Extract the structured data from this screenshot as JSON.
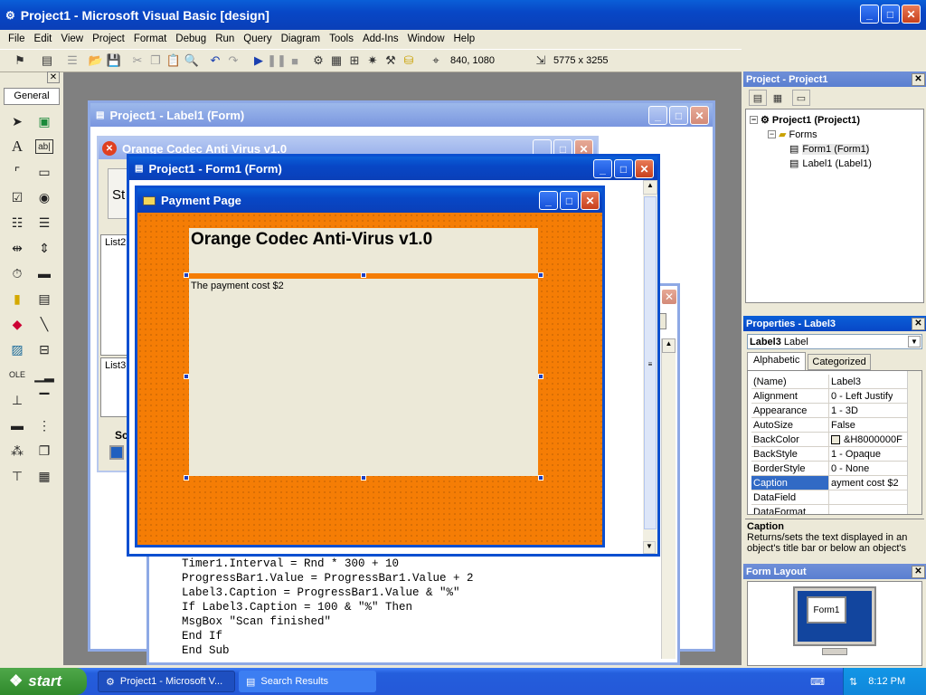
{
  "app": {
    "title": "Project1 - Microsoft Visual Basic [design]"
  },
  "menu": [
    "File",
    "Edit",
    "View",
    "Project",
    "Format",
    "Debug",
    "Run",
    "Query",
    "Diagram",
    "Tools",
    "Add-Ins",
    "Window",
    "Help"
  ],
  "toolbar": {
    "position": "840, 1080",
    "size": "5775 x 3255"
  },
  "toolbox": {
    "tab": "General"
  },
  "windows": {
    "label1_form": "Project1 - Label1 (Form)",
    "orange_codec": "Orange Codec Anti Virus v1.0",
    "form1_form": "Project1 - Form1 (Form)",
    "payment_page": "Payment Page"
  },
  "bg_form": {
    "st": "St",
    "list2": "List2",
    "list3": "List3",
    "sc": "Sc"
  },
  "payment": {
    "heading": "Orange Codec Anti-Virus v1.0",
    "cost": "The payment cost $2"
  },
  "code": [
    "Timer1.Interval = Rnd * 300 + 10",
    "ProgressBar1.Value = ProgressBar1.Value + 2",
    "Label3.Caption = ProgressBar1.Value & \"%\"",
    "If Label3.Caption = 100 & \"%\" Then",
    "MsgBox \"Scan finished\"",
    "End If",
    "End Sub"
  ],
  "project": {
    "title": "Project - Project1",
    "root": "Project1 (Project1)",
    "forms": "Forms",
    "form1": "Form1 (Form1)",
    "label1": "Label1 (Label1)"
  },
  "properties": {
    "title": "Properties - Label3",
    "object": "Label3",
    "object_type": "Label",
    "tab_alpha": "Alphabetic",
    "tab_cat": "Categorized",
    "rows": [
      [
        "(Name)",
        "Label3"
      ],
      [
        "Alignment",
        "0 - Left Justify"
      ],
      [
        "Appearance",
        "1 - 3D"
      ],
      [
        "AutoSize",
        "False"
      ],
      [
        "BackColor",
        "&H8000000F"
      ],
      [
        "BackStyle",
        "1 - Opaque"
      ],
      [
        "BorderStyle",
        "0 - None"
      ],
      [
        "Caption",
        "ayment cost $2"
      ],
      [
        "DataField",
        ""
      ],
      [
        "DataFormat",
        ""
      ]
    ],
    "desc_title": "Caption",
    "desc_text": "Returns/sets the text displayed in an object's title bar or below an object's"
  },
  "form_layout": {
    "title": "Form Layout",
    "form": "Form1"
  },
  "taskbar": {
    "start": "start",
    "items": [
      "Project1 - Microsoft V...",
      "Search Results"
    ],
    "time": "8:12 PM"
  },
  "colors": {
    "accent": "#0a5fd8",
    "orange": "#f57d05"
  }
}
